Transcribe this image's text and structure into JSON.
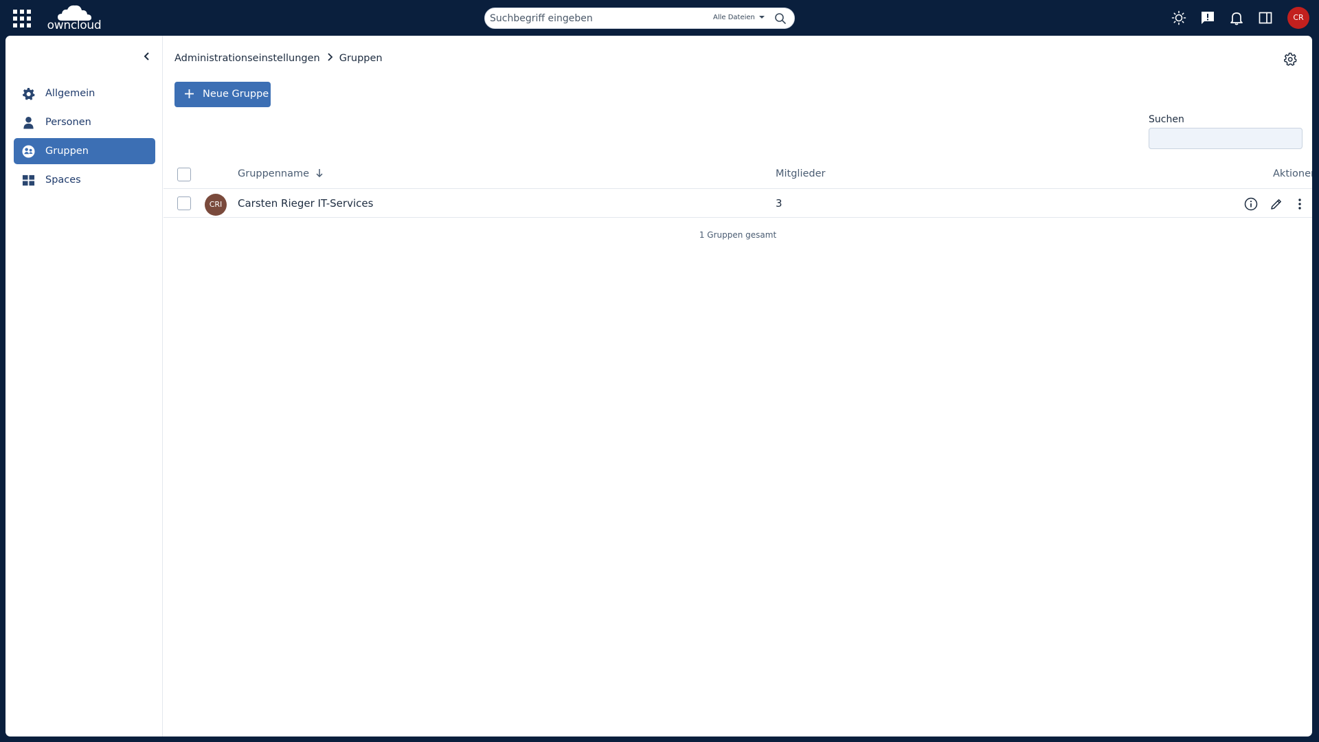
{
  "topbar": {
    "logo_text": "owncloud",
    "search": {
      "placeholder": "Suchbegriff eingeben",
      "scope": "Alle Dateien"
    },
    "user_initials": "CR"
  },
  "sidebar": {
    "items": [
      {
        "label": "Allgemein",
        "icon": "gear-icon",
        "active": false
      },
      {
        "label": "Personen",
        "icon": "person-icon",
        "active": false
      },
      {
        "label": "Gruppen",
        "icon": "groups-icon",
        "active": true
      },
      {
        "label": "Spaces",
        "icon": "grid-icon",
        "active": false
      }
    ]
  },
  "breadcrumb": {
    "root": "Administrationseinstellungen",
    "current": "Gruppen"
  },
  "toolbar": {
    "new_group_label": "Neue Gruppe"
  },
  "filter": {
    "label": "Suchen",
    "value": ""
  },
  "table": {
    "headers": {
      "name": "Gruppenname",
      "members": "Mitglieder",
      "actions": "Aktionen"
    },
    "rows": [
      {
        "initials": "CRI",
        "name": "Carsten Rieger IT-Services",
        "members": "3"
      }
    ],
    "footer": "1 Gruppen gesamt"
  },
  "colors": {
    "topbar": "#0a1f3d",
    "accent": "#3c6fb4",
    "user_avatar": "#c2201e",
    "group_avatar": "#7a4a3c"
  }
}
